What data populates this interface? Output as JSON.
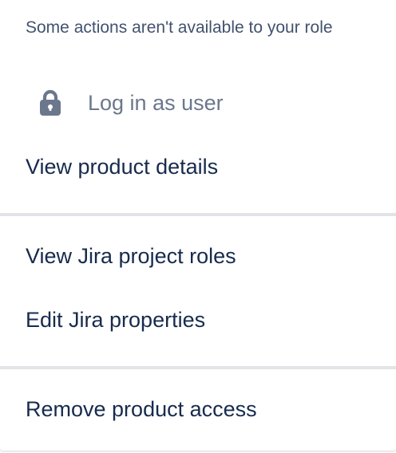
{
  "menu": {
    "notice": "Some actions aren't available to your role",
    "sections": [
      {
        "items": [
          {
            "label": "Log in as user",
            "icon": "lock-icon",
            "disabled": true
          },
          {
            "label": "View product details",
            "disabled": false
          }
        ]
      },
      {
        "items": [
          {
            "label": "View Jira project roles",
            "disabled": false
          },
          {
            "label": "Edit Jira properties",
            "disabled": false
          }
        ]
      },
      {
        "items": [
          {
            "label": "Remove product access",
            "disabled": false
          }
        ]
      }
    ]
  },
  "colors": {
    "text": "#172b4d",
    "muted_text": "#42526e",
    "disabled_text": "#6b778c",
    "icon": "#6b778c",
    "divider": "#e3e4e8"
  }
}
